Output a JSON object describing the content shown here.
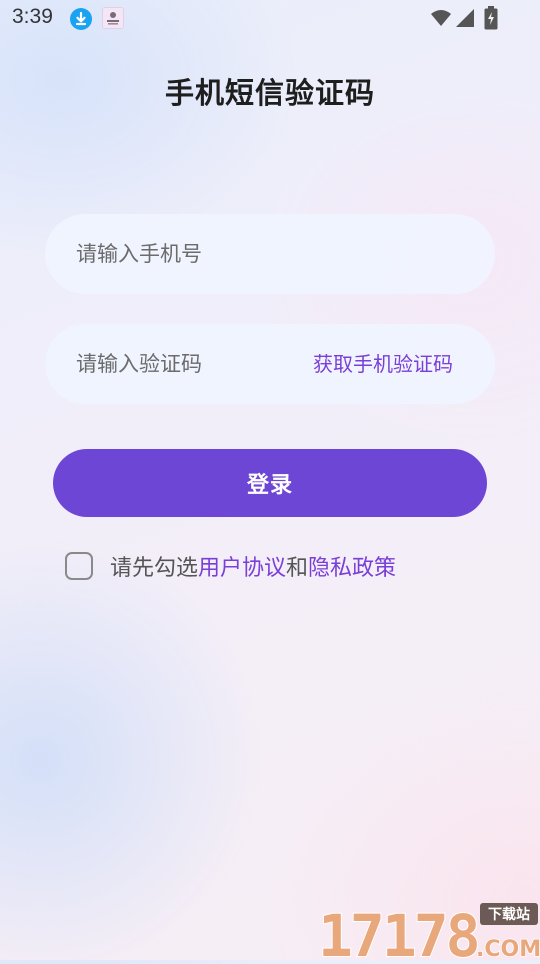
{
  "status_bar": {
    "time": "3:39"
  },
  "page": {
    "title": "手机短信验证码"
  },
  "form": {
    "phone_placeholder": "请输入手机号",
    "code_placeholder": "请输入验证码",
    "get_code_label": "获取手机验证码",
    "login_label": "登录"
  },
  "agreement": {
    "prefix": "请先勾选",
    "user_agreement": "用户协议",
    "conjunction": "和",
    "privacy_policy": "隐私政策"
  },
  "watermark": {
    "number": "17178",
    "domain": ".COM",
    "tag": "下载站"
  },
  "colors": {
    "accent": "#6e46d6",
    "link": "#7a3fd6",
    "field_bg": "#f0f4ff",
    "watermark_orange": "#e8a87c",
    "watermark_dark": "#6b5a55"
  },
  "icons": {
    "download": "download-icon",
    "app": "app-notification-icon",
    "wifi": "wifi-icon",
    "signal": "signal-icon",
    "battery": "battery-charging-icon"
  }
}
